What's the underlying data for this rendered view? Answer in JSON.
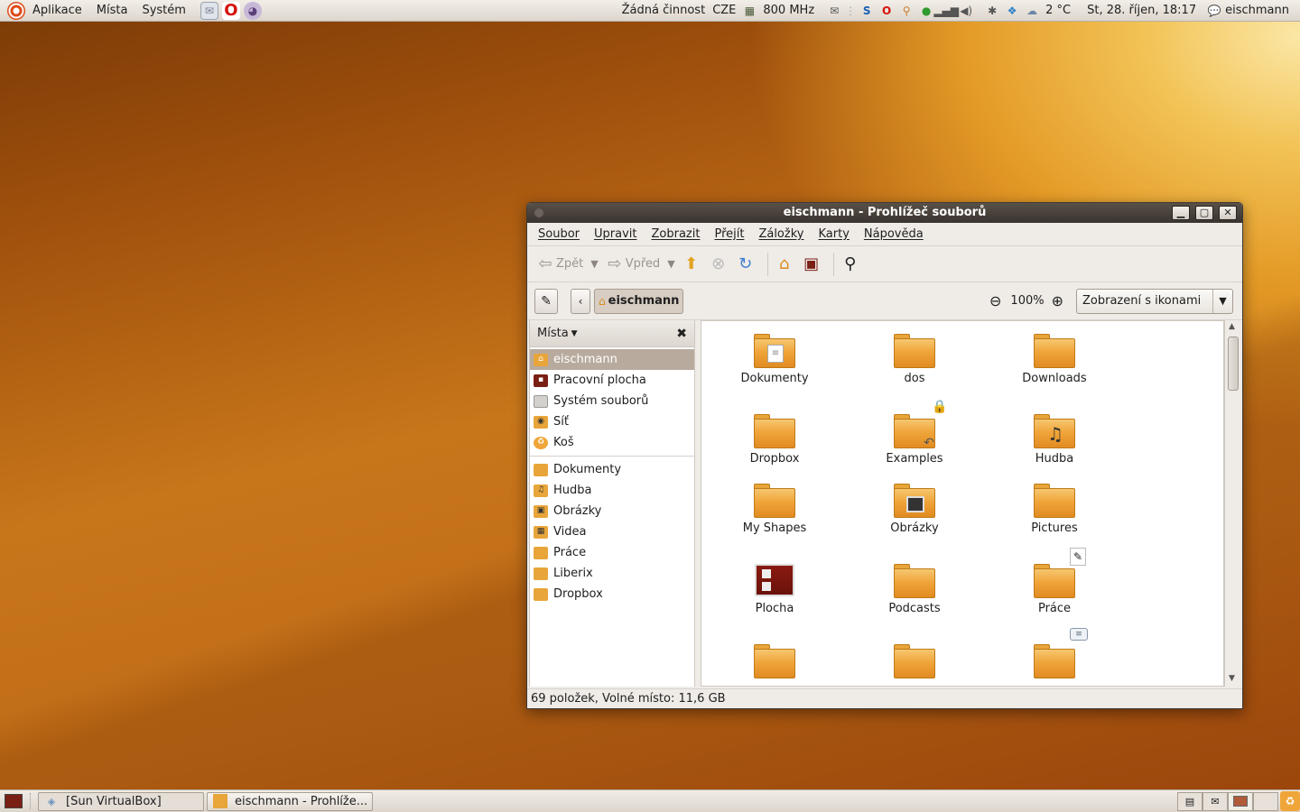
{
  "top_panel": {
    "menus": [
      "Aplikace",
      "Místa",
      "Systém"
    ],
    "activity": "Žádná činnost",
    "keyboard": "CZE",
    "cpu_freq": "800 MHz",
    "temperature": "2 °C",
    "clock": "St, 28. říjen, 18:17",
    "user": "eischmann"
  },
  "window": {
    "title": "eischmann - Prohlížeč souborů",
    "menu": [
      "Soubor",
      "Upravit",
      "Zobrazit",
      "Přejít",
      "Záložky",
      "Karty",
      "Nápověda"
    ],
    "toolbar": {
      "back": "Zpět",
      "forward": "Vpřed"
    },
    "location": {
      "crumb": "eischmann",
      "zoom": "100%",
      "view_mode": "Zobrazení s ikonami"
    },
    "sidebar": {
      "title": "Místa",
      "places": [
        {
          "label": "eischmann",
          "icon": "home-folder-icon"
        },
        {
          "label": "Pracovní plocha",
          "icon": "desktop-icon"
        },
        {
          "label": "Systém souborů",
          "icon": "filesystem-icon"
        },
        {
          "label": "Síť",
          "icon": "network-icon"
        },
        {
          "label": "Koš",
          "icon": "trash-icon"
        }
      ],
      "bookmarks": [
        {
          "label": "Dokumenty",
          "icon": "documents-folder-icon"
        },
        {
          "label": "Hudba",
          "icon": "music-folder-icon"
        },
        {
          "label": "Obrázky",
          "icon": "pictures-folder-icon"
        },
        {
          "label": "Videa",
          "icon": "videos-folder-icon"
        },
        {
          "label": "Práce",
          "icon": "folder-icon"
        },
        {
          "label": "Liberix",
          "icon": "folder-icon"
        },
        {
          "label": "Dropbox",
          "icon": "folder-icon"
        }
      ]
    },
    "files": [
      {
        "name": "Dokumenty",
        "emblem": "document-emblem"
      },
      {
        "name": "dos",
        "emblem": ""
      },
      {
        "name": "Downloads",
        "emblem": ""
      },
      {
        "name": "Dropbox",
        "emblem": ""
      },
      {
        "name": "Examples",
        "emblem": "lock-symlink-emblem"
      },
      {
        "name": "Hudba",
        "emblem": "music-note-emblem"
      },
      {
        "name": "My Shapes",
        "emblem": ""
      },
      {
        "name": "Obrázky",
        "emblem": "picture-emblem"
      },
      {
        "name": "Pictures",
        "emblem": ""
      },
      {
        "name": "Plocha",
        "emblem": "desktop-emblem"
      },
      {
        "name": "Podcasts",
        "emblem": ""
      },
      {
        "name": "Práce",
        "emblem": "pencil-emblem"
      },
      {
        "name": "",
        "emblem": ""
      },
      {
        "name": "",
        "emblem": ""
      },
      {
        "name": "",
        "emblem": "speech-emblem"
      }
    ],
    "status": "69 položek, Volné místo: 11,6 GB"
  },
  "bottom_panel": {
    "tasks": [
      "[Sun VirtualBox]",
      "eischmann - Prohlíže..."
    ]
  },
  "colors": {
    "accent": "#dd4814",
    "folder": "#f0a53a",
    "selection": "#b8ab9e",
    "titlebar": "#3a342f"
  }
}
